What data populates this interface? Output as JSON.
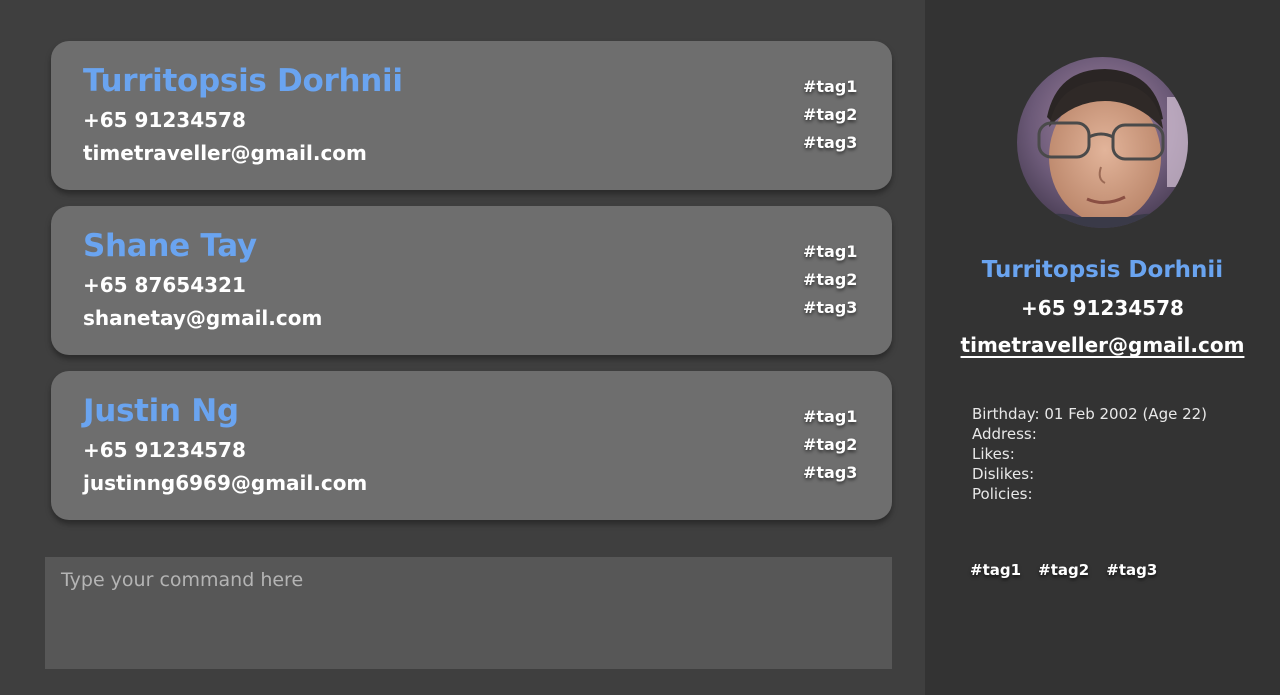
{
  "contacts": [
    {
      "name": "Turritopsis Dorhnii",
      "phone": "+65 91234578",
      "email": "timetraveller@gmail.com",
      "tags": [
        "#tag1",
        "#tag2",
        "#tag3"
      ]
    },
    {
      "name": "Shane Tay",
      "phone": "+65 87654321",
      "email": "shanetay@gmail.com",
      "tags": [
        "#tag1",
        "#tag2",
        "#tag3"
      ]
    },
    {
      "name": "Justin Ng",
      "phone": "+65 91234578",
      "email": "justinng6969@gmail.com",
      "tags": [
        "#tag1",
        "#tag2",
        "#tag3"
      ]
    }
  ],
  "command": {
    "placeholder": "Type your command here",
    "value": ""
  },
  "detail": {
    "name": "Turritopsis Dorhnii",
    "phone": "+65 91234578",
    "email": "timetraveller@gmail.com",
    "fields": [
      "Birthday: 01 Feb 2002 (Age 22)",
      "Address:",
      "Likes:",
      "Dislikes:",
      "Policies:"
    ],
    "tags": [
      "#tag1",
      "#tag2",
      "#tag3"
    ]
  },
  "colors": {
    "accent": "#6aa4f0",
    "card": "#6e6e6e",
    "background": "#3f3f3f",
    "detail_panel": "#333333",
    "command_box": "#575757"
  }
}
